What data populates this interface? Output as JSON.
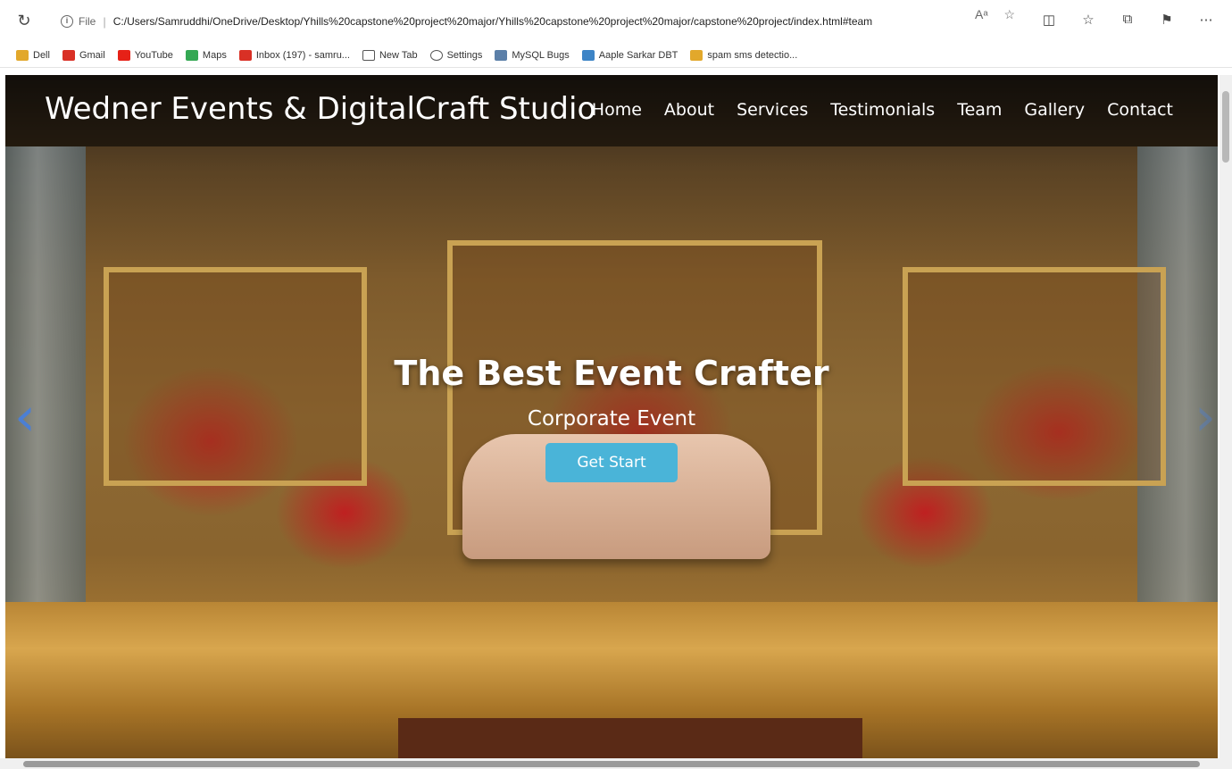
{
  "browser": {
    "file_label": "File",
    "url": "C:/Users/Samruddhi/OneDrive/Desktop/Yhills%20capstone%20project%20major/Yhills%20capstone%20project%20major/capstone%20project/index.html#team",
    "reload_icon": "reload-icon",
    "toolbar_icons": [
      "read-aloud-icon",
      "favorite-star-icon",
      "split-screen-icon",
      "favorites-icon",
      "collections-icon",
      "extensions-icon",
      "more-icon"
    ],
    "bookmarks": [
      {
        "label": "Dell",
        "color": "#e2a82b"
      },
      {
        "label": "Gmail",
        "color": "#d93025"
      },
      {
        "label": "YouTube",
        "color": "#e62117"
      },
      {
        "label": "Maps",
        "color": "#34a853"
      },
      {
        "label": "Inbox (197) - samru...",
        "color": "#d93025"
      },
      {
        "label": "New Tab",
        "color": "#555555"
      },
      {
        "label": "Settings",
        "color": "#555555"
      },
      {
        "label": "MySQL Bugs",
        "color": "#5b7fa8"
      },
      {
        "label": "Aaple Sarkar DBT",
        "color": "#3d84c6"
      },
      {
        "label": "spam sms detectio...",
        "color": "#e2a82b"
      }
    ]
  },
  "page": {
    "brand": "Wedner Events & DigitalCraft Studio",
    "nav": [
      "Home",
      "About",
      "Services",
      "Testimonials",
      "Team",
      "Gallery",
      "Contact"
    ],
    "hero": {
      "title": "The Best Event Crafter",
      "subtitle": "Corporate Event",
      "button": "Get Start"
    },
    "accent_color": "#4ab4d8"
  }
}
